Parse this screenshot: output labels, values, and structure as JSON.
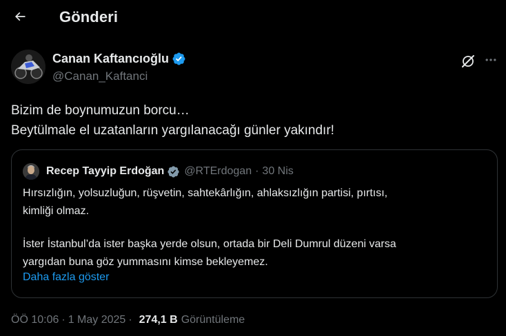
{
  "header": {
    "title": "Gönderi",
    "back_icon": "arrow-left-icon"
  },
  "author": {
    "name": "Canan Kaftancıoğlu",
    "handle": "@Canan_Kaftanci",
    "verified": true,
    "verified_color": "#1d9bf0"
  },
  "post": {
    "lines": [
      "Bizim de boynumuzun borcu…",
      "Beytülmale el uzatanların yargılanacağı günler yakındır!"
    ]
  },
  "quote": {
    "author_name": "Recep Tayyip Erdoğan",
    "verified_color": "#829aab",
    "handle": "@RTErdogan",
    "separator": "·",
    "date": "30 Nis",
    "paragraph1": [
      "Hırsızlığın, yolsuzluğun, rüşvetin, sahtekârlığın, ahlaksızlığın partisi, pırtısı,",
      "kimliği olmaz."
    ],
    "paragraph2": [
      "İster İstanbul’da ister başka yerde olsun, ortada bir Deli Dumrul düzeni varsa",
      "yargıdan buna göz yummasını kimse bekleyemez."
    ],
    "show_more": "Daha fazla göster"
  },
  "meta": {
    "time": "ÖÖ 10:06",
    "dot": "·",
    "date": "1 May 2025",
    "dot2": "·",
    "views_count": "274,1 B",
    "views_label": "Görüntüleme"
  },
  "colors": {
    "background": "#000000",
    "text": "#e7e9ea",
    "secondary": "#71767b",
    "accent": "#1d9bf0",
    "border": "#2f3336"
  }
}
